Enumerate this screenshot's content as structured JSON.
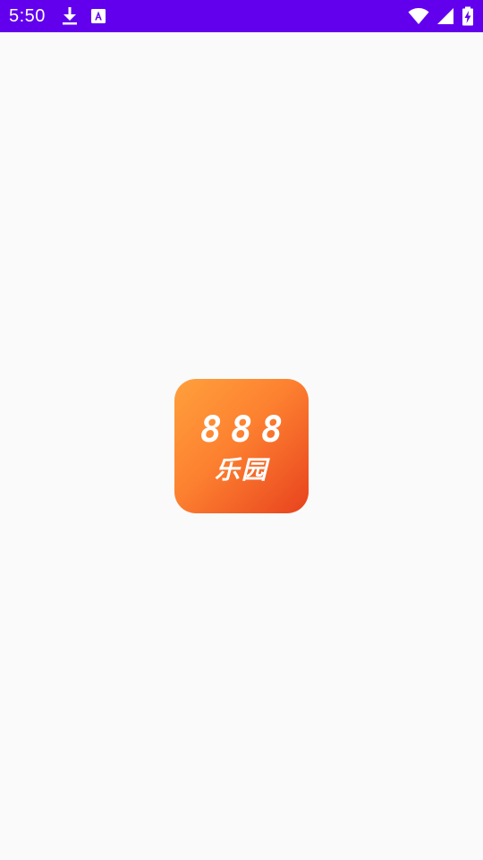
{
  "status_bar": {
    "time": "5:50",
    "background_color": "#6200ee",
    "left_icons": [
      "download-icon",
      "font-a-icon"
    ],
    "right_icons": [
      "wifi-icon",
      "cell-signal-icon",
      "battery-charging-icon"
    ]
  },
  "splash": {
    "logo_numbers": "888",
    "logo_name": "乐园",
    "gradient_start": "#ffa03c",
    "gradient_end": "#e8421e"
  }
}
